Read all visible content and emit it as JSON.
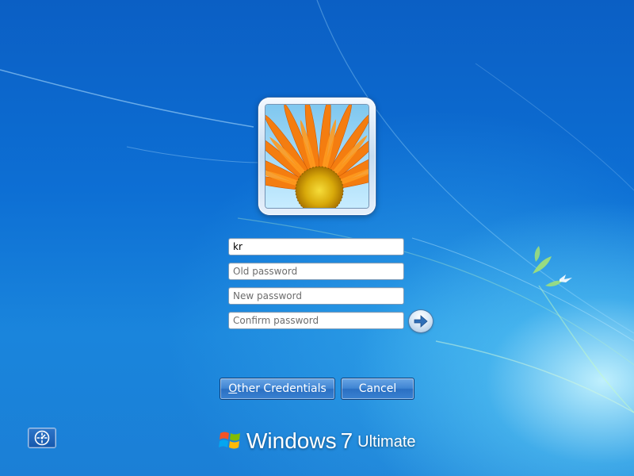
{
  "credentials": {
    "username_value": "kr",
    "old_password_placeholder": "Old password",
    "new_password_placeholder": "New password",
    "confirm_password_placeholder": "Confirm password"
  },
  "buttons": {
    "other_credentials_accel": "O",
    "other_credentials_rest": "ther Credentials",
    "cancel": "Cancel"
  },
  "branding": {
    "name": "Windows",
    "version": "7",
    "edition": "Ultimate"
  },
  "icons": {
    "submit": "arrow-right-icon",
    "ease_of_access": "ease-of-access-icon",
    "logo": "windows-flag-icon",
    "user_tile": "orange-flower-picture"
  },
  "colors": {
    "background": "#1370d0",
    "button": "#3a82d2",
    "flower": "#f57a10"
  }
}
